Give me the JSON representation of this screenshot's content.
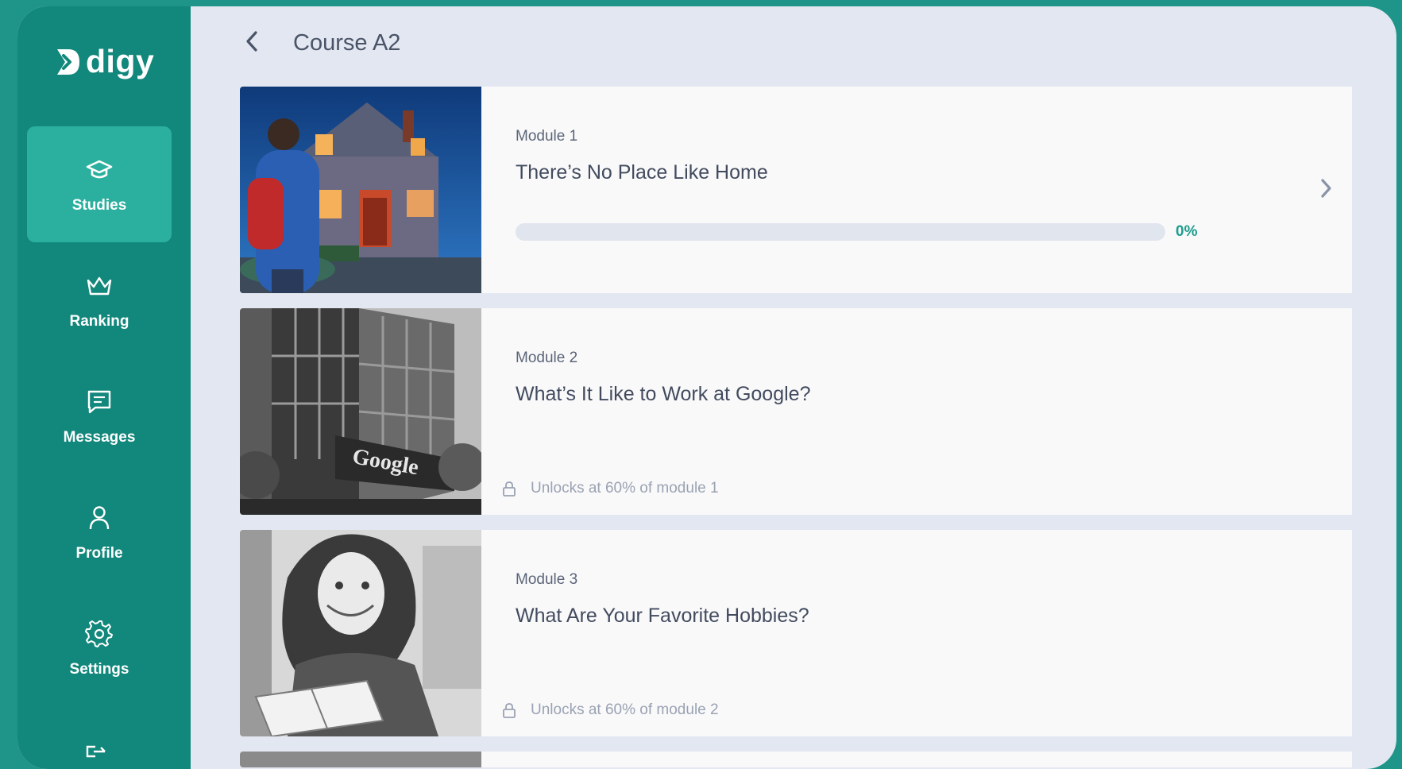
{
  "app": {
    "logo_text": "digy",
    "brand_color": "#12877b",
    "accent_color": "#1f9e8f"
  },
  "sidebar": {
    "items": [
      {
        "label": "Studies",
        "icon": "graduation-cap-icon",
        "active": true
      },
      {
        "label": "Ranking",
        "icon": "crown-icon",
        "active": false
      },
      {
        "label": "Messages",
        "icon": "message-icon",
        "active": false
      },
      {
        "label": "Profile",
        "icon": "user-icon",
        "active": false
      },
      {
        "label": "Settings",
        "icon": "gear-icon",
        "active": false
      }
    ]
  },
  "header": {
    "title": "Course A2",
    "back_icon": "chevron-left-icon"
  },
  "modules": [
    {
      "label": "Module 1",
      "title": "There’s No Place Like Home",
      "progress_percent": 0,
      "progress_text": "0%",
      "locked": false,
      "image": "illustration of a young man with a red backpack looking at a lit suburban house at dusk"
    },
    {
      "label": "Module 2",
      "title": "What’s It Like to Work at Google?",
      "locked": true,
      "lock_text": "Unlocks at 60% of module 1",
      "image": "grayscale illustration of a modern Google office building"
    },
    {
      "label": "Module 3",
      "title": "What Are Your Favorite Hobbies?",
      "locked": true,
      "lock_text": "Unlocks at 60% of module 2",
      "image": "grayscale illustration of a smiling woman reading a book"
    }
  ]
}
